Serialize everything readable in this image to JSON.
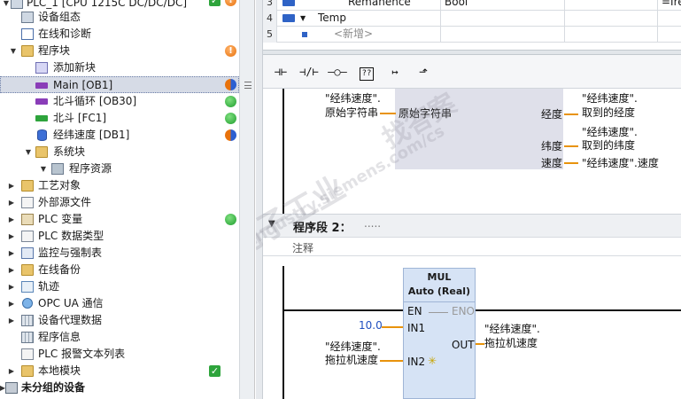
{
  "tree": {
    "items": [
      {
        "label": "PLC_1 [CPU 1215C DC/DC/DC]",
        "status": "check-orange"
      },
      {
        "label": "设备组态"
      },
      {
        "label": "在线和诊断"
      },
      {
        "label": "程序块",
        "status": "orange"
      },
      {
        "label": "添加新块"
      },
      {
        "label": "Main [OB1]",
        "status": "split"
      },
      {
        "label": "北斗循环 [OB30]",
        "status": "green"
      },
      {
        "label": "北斗 [FC1]",
        "status": "green"
      },
      {
        "label": "经纬速度 [DB1]",
        "status": "split"
      },
      {
        "label": "系统块"
      },
      {
        "label": "程序资源"
      },
      {
        "label": "工艺对象"
      },
      {
        "label": "外部源文件"
      },
      {
        "label": "PLC 变量",
        "status": "green"
      },
      {
        "label": "PLC 数据类型"
      },
      {
        "label": "监控与强制表"
      },
      {
        "label": "在线备份"
      },
      {
        "label": "轨迹"
      },
      {
        "label": "OPC UA 通信"
      },
      {
        "label": "设备代理数据"
      },
      {
        "label": "程序信息"
      },
      {
        "label": "PLC 报警文本列表"
      },
      {
        "label": "本地模块",
        "status": "check"
      },
      {
        "label": "未分组的设备"
      }
    ]
  },
  "interface": {
    "rows": [
      {
        "num": "3",
        "name": "Remanence",
        "type": "Bool",
        "extra": "=Ire"
      },
      {
        "num": "4",
        "name": "Temp"
      },
      {
        "num": "5",
        "name": "<新增>"
      }
    ]
  },
  "network1": {
    "in_var_line1": "\"经纬速度\".",
    "in_var_line2": "原始字符串",
    "block_in_pin": "原始字符串",
    "pins_out": [
      "经度",
      "纬度",
      "速度"
    ],
    "out1_line1": "\"经纬速度\".",
    "out1_line2": "取到的经度",
    "out2_line1": "\"经纬速度\".",
    "out2_line2": "取到的纬度",
    "out3": "\"经纬速度\".速度"
  },
  "network2": {
    "title": "程序段 2：",
    "dots": ".....",
    "comment": "注释",
    "block_title": "MUL",
    "block_type": "Auto (Real)",
    "en": "EN",
    "eno": "ENO",
    "in1": "IN1",
    "in2": "IN2",
    "out": "OUT",
    "in1_value": "10.0",
    "in2_line1": "\"经纬速度\".",
    "in2_line2": "拖拉机速度",
    "out_line1": "\"经纬速度\".",
    "out_line2": "拖拉机速度"
  },
  "watermark": {
    "cn": "西门子工业",
    "cn2": "找答案",
    "url": "support.industry.siemens.com/cs"
  }
}
